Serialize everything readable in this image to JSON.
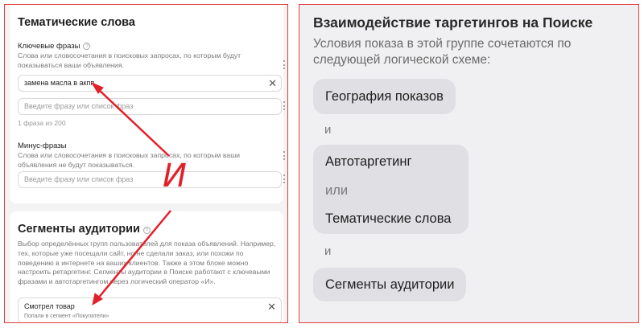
{
  "left": {
    "keywords_section": {
      "title": "Тематические слова",
      "phrases_label": "Ключевые фразы",
      "phrases_desc": "Слова или словосочетания в поисковых запросах, по которым будут показываться ваши объявления.",
      "phrase_value": "замена масла в акпп",
      "phrase_placeholder": "Введите фразу или список фраз",
      "phrase_count": "1 фраза из 200",
      "minus_label": "Минус-фразы",
      "minus_desc": "Слова или словосочетания в поисковых запросах, по которым ваши объявления не будут показываться.",
      "minus_placeholder": "Введите фразу или список фраз"
    },
    "audience_section": {
      "title": "Сегменты аудитории",
      "desc": "Выбор определённых групп пользователей для показа объявлений. Например, тех, которые уже посещали сайт, но не сделали заказ, или похожи по поведению в интернете на ваших клиентов. Также в этом блоке можно настроить ретаргетинг. Сегменты аудитории в Поиске работают с ключевыми фразами и автотаргетингом через логический оператор «И».",
      "segment_name": "Смотрел товар",
      "segment_sub": "Попали в сегмент «Покупатели»"
    },
    "annotation": "И",
    "help_glyph": "?",
    "clear_glyph": "✕"
  },
  "right": {
    "title": "Взаимодействие таргетингов на Поиске",
    "subtitle": "Условия показа в этой группе сочетаются по следующей логической схеме:",
    "geo": "География показов",
    "and_1": "и",
    "autotargeting": "Автотаргетинг",
    "or": "или",
    "thematic": "Тематические слова",
    "and_2": "и",
    "segments": "Сегменты аудитории"
  },
  "colors": {
    "annotation_red": "#e3202a",
    "frame_red": "#e23b3b",
    "pill_bg": "#e0e0e4"
  }
}
